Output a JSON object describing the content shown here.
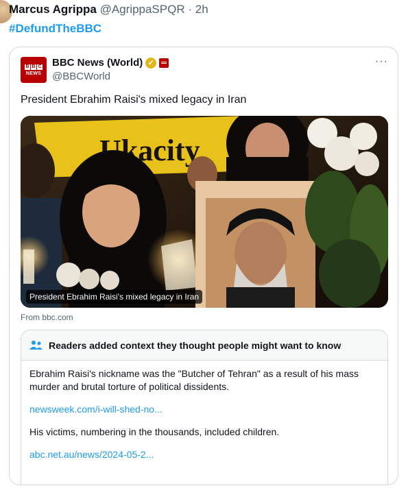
{
  "tweet": {
    "author_name": "Marcus Agrippa",
    "author_handle": "@AgrippaSPQR",
    "separator": "·",
    "time": "2h",
    "text": "#DefundTheBBC"
  },
  "quoted": {
    "name": "BBC News (World)",
    "handle": "@BBCWorld",
    "logo_text": [
      "B",
      "B",
      "C"
    ],
    "logo_sub": "NEWS",
    "text": "President Ebrahim Raisi's mixed legacy in Iran",
    "media_caption": "President Ebrahim Raisi's mixed legacy in Iran",
    "media_banner_text": "Ukacity",
    "link_source": "From bbc.com",
    "more_icon": "more-horizontal-icon"
  },
  "community_note": {
    "title": "Readers added context they thought people might want to know",
    "paragraph_1": "Ebrahim Raisi's nickname was the \"Butcher of Tehran\" as a result of his mass murder and brutal torture of political dissidents.",
    "link_1": "newsweek.com/i-will-shed-no...",
    "paragraph_2": "His victims, numbering in the thousands, included children.",
    "link_2": "abc.net.au/news/2024-05-2..."
  },
  "colors": {
    "link_blue": "#1d9bf0",
    "bbc_red": "#b80000",
    "verified_gold": "#e2b719",
    "secondary_text": "#536471"
  }
}
